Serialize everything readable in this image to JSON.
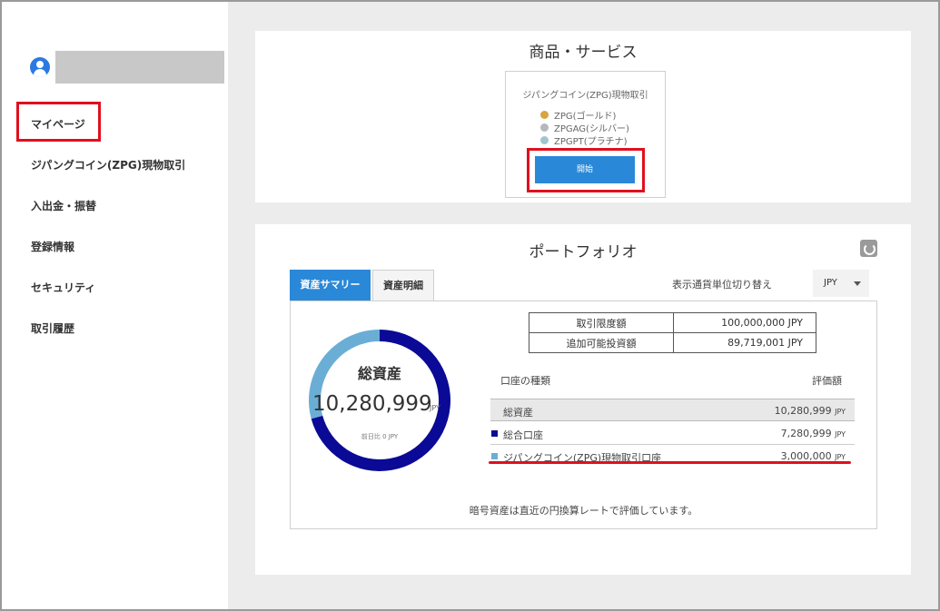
{
  "sidebar": {
    "items": [
      {
        "label": "マイページ"
      },
      {
        "label": "ジパングコイン(ZPG)現物取引"
      },
      {
        "label": "入出金・振替"
      },
      {
        "label": "登録情報"
      },
      {
        "label": "セキュリティ"
      },
      {
        "label": "取引履歴"
      }
    ]
  },
  "services": {
    "title": "商品・サービス",
    "card_title": "ジパングコイン(ZPG)現物取引",
    "items": [
      {
        "label": "ZPG(ゴールド)",
        "color": "#d9a441"
      },
      {
        "label": "ZPGAG(シルバー)",
        "color": "#b4b8bd"
      },
      {
        "label": "ZPGPT(プラチナ)",
        "color": "#9fc6cf"
      }
    ],
    "start_label": "開始"
  },
  "portfolio": {
    "title": "ポートフォリオ",
    "tabs": [
      {
        "label": "資産サマリー",
        "active": true
      },
      {
        "label": "資産明細",
        "active": false
      }
    ],
    "currency_label": "表示通貨単位切り替え",
    "currency_value": "JPY",
    "total_label": "総資産",
    "total_value": "10,280,999",
    "total_unit": "JPY",
    "change_label": "前日比 0 JPY",
    "limits": [
      {
        "label": "取引限度額",
        "value": "100,000,000  JPY"
      },
      {
        "label": "追加可能投資額",
        "value": "89,719,001  JPY"
      }
    ],
    "account_header": "口座の種類",
    "value_header": "評価額",
    "accounts": [
      {
        "name": "総資産",
        "amount": "10,280,999",
        "unit": "JPY"
      },
      {
        "name": "総合口座",
        "amount": "7,280,999",
        "unit": "JPY",
        "color": "#0a0a96"
      },
      {
        "name": "ジパングコイン(ZPG)現物取引口座",
        "amount": "3,000,000",
        "unit": "JPY",
        "color": "#6aaed6"
      }
    ],
    "donut_values": [
      7280999,
      3000000
    ],
    "donut_colors": [
      "#0a0a96",
      "#6aaed6"
    ],
    "note": "暗号資産は直近の円換算レートで評価しています。"
  }
}
